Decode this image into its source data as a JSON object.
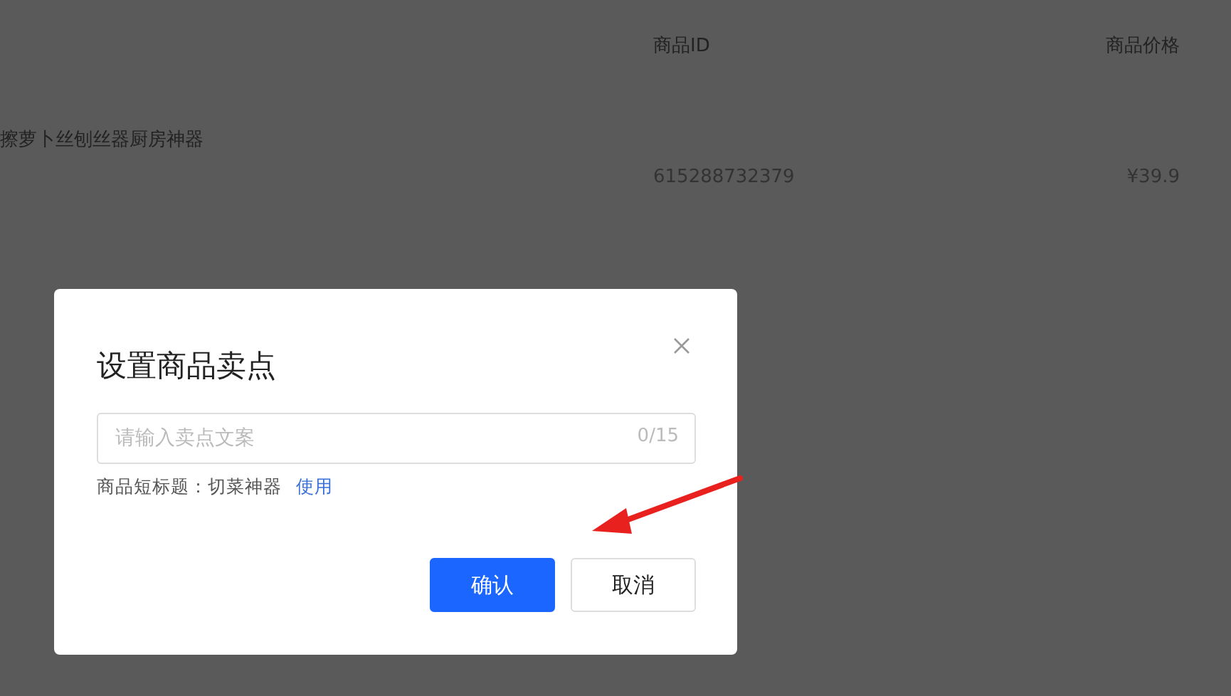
{
  "table": {
    "columns": [
      "商品ID",
      "商品价格"
    ],
    "rows": [
      {
        "name": "擦萝卜丝刨丝器厨房神器",
        "id": "615288732379",
        "price": "¥39.9"
      }
    ]
  },
  "dialog": {
    "title": "设置商品卖点",
    "input": {
      "placeholder": "请输入卖点文案",
      "counter": "0/15"
    },
    "hint": {
      "label": "商品短标题：切菜神器",
      "link": "使用"
    },
    "buttons": [
      {
        "label": "确认",
        "kind": "primary"
      },
      {
        "label": "取消",
        "kind": "default"
      }
    ]
  }
}
